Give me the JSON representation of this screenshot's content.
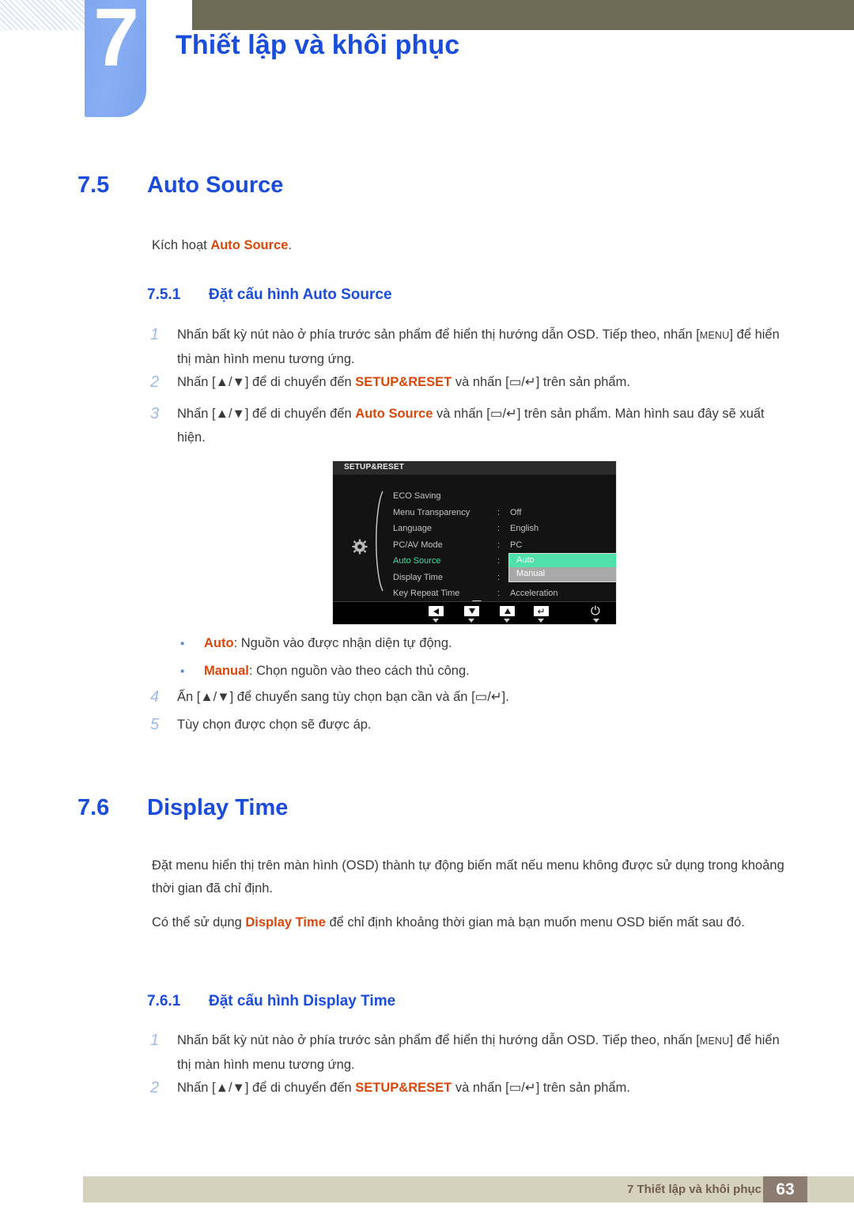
{
  "header": {
    "chapter_number": "7",
    "chapter_title": "Thiết lập và khôi phục"
  },
  "sections": [
    {
      "number": "7.5",
      "title": "Auto Source",
      "intro_pre": "Kích hoạt ",
      "intro_hl": "Auto Source",
      "intro_post": ".",
      "sub_number": "7.5.1",
      "sub_title": "Đặt cấu hình Auto Source"
    },
    {
      "number": "7.6",
      "title": "Display Time",
      "para1": "Đặt menu hiển thị trên màn hình (OSD) thành tự động biến mất nếu menu không được sử dụng trong khoảng thời gian đã chỉ định.",
      "para2_pre": "Có thể sử dụng ",
      "para2_hl": "Display Time",
      "para2_post": " để chỉ định khoảng thời gian mà bạn muốn menu OSD biến mất sau đó.",
      "sub_number": "7.6.1",
      "sub_title": "Đặt cấu hình Display Time"
    }
  ],
  "steps_auto_source": {
    "s1_num": "1",
    "s1_a": "Nhấn bất kỳ nút nào ở phía trước sản phẩm để hiển thị hướng dẫn OSD. Tiếp theo, nhấn [",
    "s1_key": "MENU",
    "s1_b": "] để hiển thị màn hình menu tương ứng.",
    "s2_num": "2",
    "s2_a": "Nhấn [▲/▼] để di chuyển đến ",
    "s2_hl": "SETUP&RESET",
    "s2_b": " và nhấn [▭/↵] trên sản phẩm.",
    "s3_num": "3",
    "s3_a": "Nhấn [▲/▼] để di chuyển đến ",
    "s3_hl": "Auto Source",
    "s3_b": " và nhấn [▭/↵] trên sản phẩm. Màn hình sau đây sẽ xuất hiện.",
    "s4_num": "4",
    "s4_a": "Ấn [▲/▼] để chuyển sang tùy chọn bạn cần và ấn [▭/↵].",
    "s5_num": "5",
    "s5_a": "Tùy chọn được chọn sẽ được áp."
  },
  "bullets": [
    {
      "dot": "▪",
      "term": "Auto",
      "desc": ": Nguồn vào được nhận diện tự động."
    },
    {
      "dot": "▪",
      "term": "Manual",
      "desc": ": Chọn nguồn vào theo cách thủ công."
    }
  ],
  "steps_display_time": {
    "s1_num": "1",
    "s1_a": "Nhấn bất kỳ nút nào ở phía trước sản phẩm để hiển thị hướng dẫn OSD. Tiếp theo, nhấn [",
    "s1_key": "MENU",
    "s1_b": "] để hiển thị màn hình menu tương ứng.",
    "s2_num": "2",
    "s2_a": "Nhấn [▲/▼] để di chuyển đến ",
    "s2_hl": "SETUP&RESET",
    "s2_b": " và nhấn [▭/↵] trên sản phẩm."
  },
  "osd": {
    "title": "SETUP&RESET",
    "icon": "gear-icon",
    "items": [
      {
        "label": "ECO Saving",
        "colon": "",
        "value": "",
        "arrow": true,
        "selected": false
      },
      {
        "label": "Menu Transparency",
        "colon": ":",
        "value": "Off",
        "arrow": false,
        "selected": false
      },
      {
        "label": "Language",
        "colon": ":",
        "value": "English",
        "arrow": false,
        "selected": false
      },
      {
        "label": "PC/AV Mode",
        "colon": ":",
        "value": "PC",
        "arrow": false,
        "selected": false
      },
      {
        "label": "Auto Source",
        "colon": ":",
        "value": "",
        "arrow": false,
        "selected": true
      },
      {
        "label": "Display Time",
        "colon": ":",
        "value": "",
        "arrow": false,
        "selected": false
      },
      {
        "label": "Key Repeat Time",
        "colon": ":",
        "value": "Acceleration",
        "arrow": false,
        "selected": false
      }
    ],
    "popup_options": [
      {
        "label": "Auto",
        "active": true
      },
      {
        "label": "Manual",
        "active": false
      }
    ],
    "footer_buttons": [
      {
        "name": "left-arrow-button",
        "glyph": "left"
      },
      {
        "name": "down-arrow-button",
        "glyph": "down"
      },
      {
        "name": "up-arrow-button",
        "glyph": "up"
      },
      {
        "name": "enter-button",
        "glyph": "enter"
      }
    ],
    "power_glyph": "⏻",
    "highlight_color": "#4fe0ab",
    "selected_label_color": "#3ddca0"
  },
  "footer": {
    "text": "7 Thiết lập và khôi phục",
    "page_number": "63"
  }
}
